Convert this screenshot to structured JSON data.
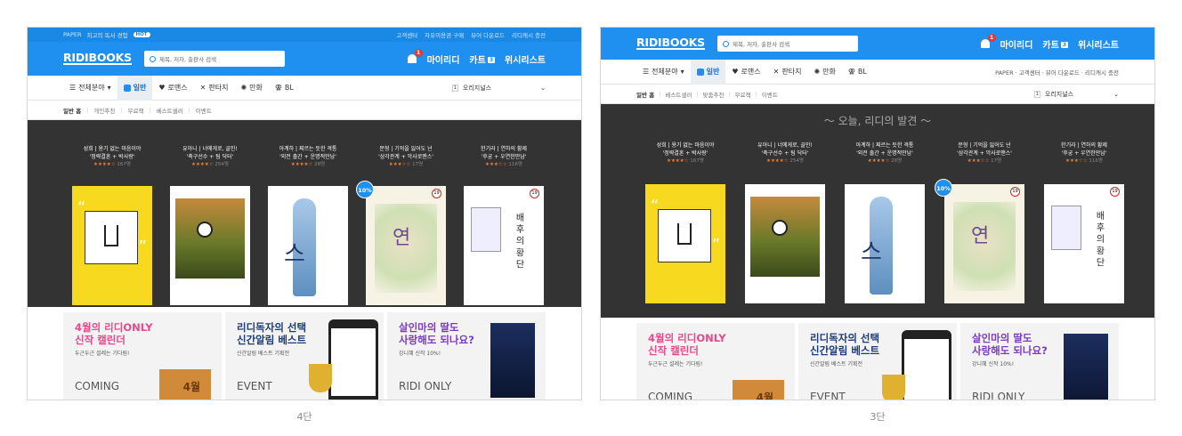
{
  "topbar": {
    "brand": "PAPER",
    "promo": "최고의 독서 경험",
    "hot": "HOT",
    "links": [
      "고객센터",
      "자유이용권 구매",
      "뷰어 다운로드",
      "리디캐시 충전"
    ],
    "links_p3": "PAPER · 고객센터 · 뷰어 다운로드 · 리디캐시 충전"
  },
  "header": {
    "logo": "RIDIBOOKS",
    "search_placeholder": "제목, 저자, 출판사 검색",
    "notif_count": "1",
    "my": "마이리디",
    "cart": "카트",
    "cart_count": "3",
    "wish": "위시리스트"
  },
  "nav": {
    "items": [
      "전체분야",
      "일반",
      "로맨스",
      "판타지",
      "만화",
      "BL"
    ],
    "orig_num": "1",
    "originals": "오리지널스"
  },
  "subnav": {
    "p4": [
      "일반 홈",
      "개인추천",
      "무료책",
      "베스트셀러",
      "이벤트"
    ],
    "p3": [
      "일반 홈",
      "베스트셀러",
      "맞춤추천",
      "무료책",
      "이벤트"
    ]
  },
  "today_title": "오늘, 리디의 발견",
  "books": [
    {
      "t1": "성희 | 용기 없는 마음이야",
      "t2": "'정략결혼 + 박사랑'",
      "stars": "★★★★☆",
      "count": "167명",
      "color": "#f7d91f"
    },
    {
      "t1": "유아니 | 너에게로, 골인!",
      "t2": "'축구선수 + 팀 닥터'",
      "stars": "★★★★☆",
      "count": "254명",
      "color": "#ffffff"
    },
    {
      "t1": "아계하 | 찌르는 듯한 격통",
      "t2": "'외전 출간 + 운명적만남'",
      "stars": "★★★★☆",
      "count": "28명",
      "color": "#ffffff"
    },
    {
      "t1": "문형 | 기억을 잃어도 넌",
      "t2": "'삼각관계 + 악사로맨스'",
      "stars": "★★★☆☆",
      "count": "17명",
      "color": "#f6f2e4"
    },
    {
      "t1": "한기라 | 연하의 황제",
      "t2": "'후궁 + 우연한만남'",
      "stars": "★★★☆☆",
      "count": "116명",
      "color": "#ffffff"
    }
  ],
  "badge_discount": "10%",
  "badge_age": "19",
  "banners": [
    {
      "h1": "4월의 리디ONLY",
      "h2": "신작 캘린더",
      "s": "두근두근 설레는 기다림!",
      "f": "COMING",
      "color": "#e64a8a"
    },
    {
      "h1": "리디독자의 선택",
      "h2": "신간알림 베스트",
      "s": "신간알림 베스트 기획전",
      "f": "EVENT",
      "color": "#1d3b7a"
    },
    {
      "h1": "살인마의 딸도",
      "h2": "사랑해도 되나요?",
      "s": "강니혜 신작 10%!",
      "f": "RIDI ONLY",
      "color": "#7a3cc0"
    }
  ],
  "basket_label": "4월",
  "captions": {
    "p4": "4단",
    "p3": "3단"
  }
}
